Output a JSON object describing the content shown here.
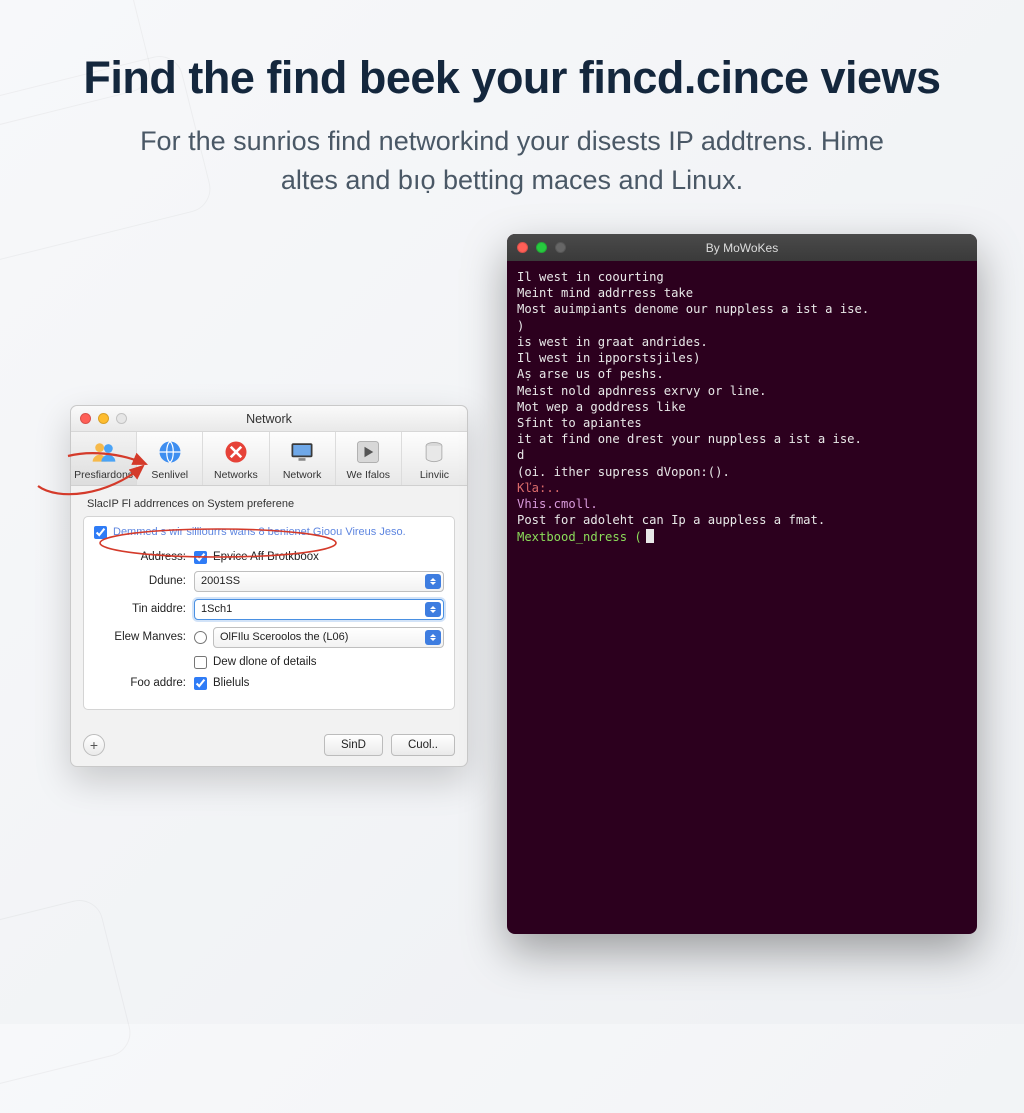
{
  "hero": {
    "title": "Find the find beek your fincd.cince views",
    "subtitle_line1": "For the sunrios find networkind your disests IP addtrens. Hime",
    "subtitle_line2": "altes and bıọ betting maces and Linux."
  },
  "mac": {
    "title": "Network",
    "toolbar": [
      {
        "label": "Presfiardons",
        "icon": "people-icon"
      },
      {
        "label": "Senlivel",
        "icon": "globe-icon"
      },
      {
        "label": "Networks",
        "icon": "cancel-icon"
      },
      {
        "label": "Network",
        "icon": "display-icon"
      },
      {
        "label": "We Ifalos",
        "icon": "play-icon"
      },
      {
        "label": "Linviic",
        "icon": "cylinder-icon"
      }
    ],
    "section_label": "SlacIP Fl addrrences on System preferene",
    "note": "Demmed s wir silliourrs wans 8 benienet Gioou Vireus Jeso.",
    "rows": {
      "address_label": "Address:",
      "address_check": "Epvice Aff Brotkboox",
      "ddune_label": "Ddune:",
      "ddune_value": "2001SS",
      "tin_label": "Tin aiddre:",
      "tin_value": "1Sch1",
      "elew_label": "Elew Manves:",
      "elew_value": "OlFIlu Sceroolos the (L06)",
      "dew_label": "Dew dlone of details",
      "foo_label": "Foo addre:",
      "foo_check": "Blieluls"
    },
    "buttons": {
      "sind": "SinD",
      "cuoi": "Cuol.."
    }
  },
  "terminal": {
    "title": "By MoWoKes",
    "lines": [
      {
        "cls": "",
        "txt": "Il west in coourting"
      },
      {
        "cls": "",
        "txt": "Meint mind addrress take"
      },
      {
        "cls": "",
        "txt": "Most auimpiants denome our nuppless a ist a ise."
      },
      {
        "cls": "",
        "txt": ")"
      },
      {
        "cls": "",
        "txt": "is west in graat andrides."
      },
      {
        "cls": "",
        "txt": "Il west in ipporstsjiles)"
      },
      {
        "cls": "",
        "txt": "Aṣ arse us of peshs."
      },
      {
        "cls": "",
        "txt": "Meist nold apdnress exrvy or line."
      },
      {
        "cls": "",
        "txt": "Mot wep a goddrеss like"
      },
      {
        "cls": "",
        "txt": "Sfint to арiantes"
      },
      {
        "cls": "",
        "txt": "it at find one drest your nuppless a ist a ise."
      },
      {
        "cls": "",
        "txt": "d"
      },
      {
        "cls": "",
        "txt": "(oi. ither supress dVopon:()."
      },
      {
        "cls": "red",
        "txt": "Kľa:.."
      },
      {
        "cls": "mag",
        "txt": "Vhis.cmoll."
      },
      {
        "cls": "",
        "txt": "Post for adoleht can Ip a auppless a fmat."
      },
      {
        "cls": "green",
        "txt": "Mextbood_ndress ("
      }
    ]
  }
}
